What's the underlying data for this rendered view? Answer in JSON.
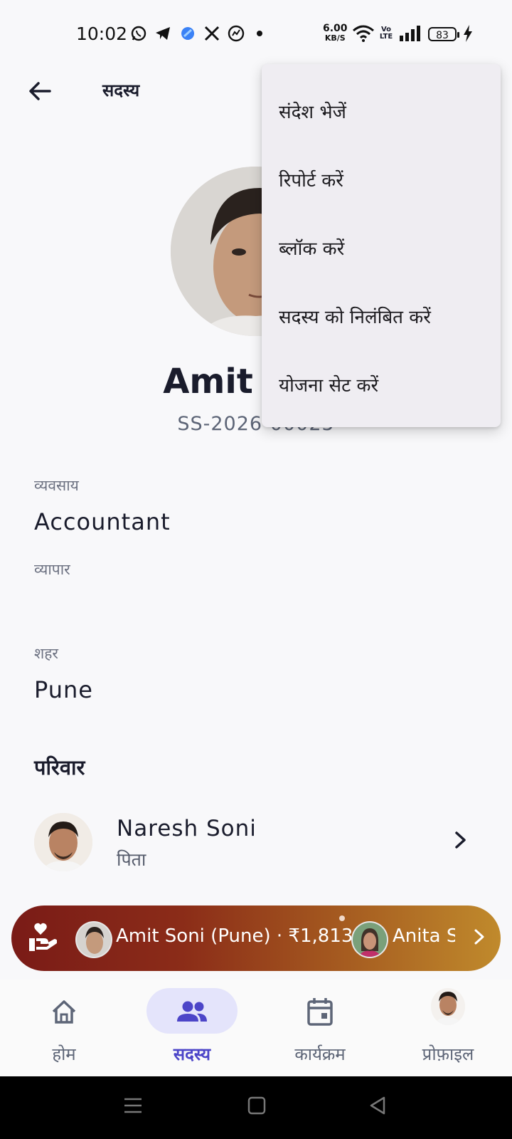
{
  "status_bar": {
    "time": "10:02",
    "net_speed_value": "6.00",
    "net_speed_unit": "KB/S",
    "volte": "Vo LTE",
    "battery": "83",
    "notification_icons": [
      "whatsapp-icon",
      "telegram-icon",
      "app-icon",
      "x-icon",
      "threads-icon",
      "dot-icon"
    ]
  },
  "header": {
    "title": "सदस्य"
  },
  "profile": {
    "name": "Amit Soni",
    "member_id": "SS-2026-00025",
    "fields": [
      {
        "label": "व्यवसाय",
        "value": "Accountant"
      },
      {
        "label": "व्यापार",
        "value": ""
      },
      {
        "label": "शहर",
        "value": "Pune"
      }
    ]
  },
  "family": {
    "title": "परिवार",
    "members": [
      {
        "name": "Naresh Soni",
        "relation": "पिता"
      }
    ]
  },
  "donation_banner": {
    "items": [
      {
        "text": "Amit Soni (Pune) · ₹1,813"
      },
      {
        "text": "Anita S"
      }
    ]
  },
  "bottom_nav": {
    "items": [
      {
        "label": "होम",
        "icon": "home-icon",
        "active": false
      },
      {
        "label": "सदस्य",
        "icon": "members-icon",
        "active": true
      },
      {
        "label": "कार्यक्रम",
        "icon": "calendar-icon",
        "active": false
      },
      {
        "label": "प्रोफ़ाइल",
        "icon": "avatar",
        "active": false
      }
    ]
  },
  "overflow_menu": {
    "items": [
      {
        "label": "संदेश भेजें"
      },
      {
        "label": "रिपोर्ट करें"
      },
      {
        "label": "ब्लॉक करें"
      },
      {
        "label": "सदस्य को निलंबित करें"
      },
      {
        "label": "योजना सेट करें"
      }
    ]
  },
  "colors": {
    "accent": "#4c45c8",
    "nav_pill": "#e4e4fb",
    "banner_start": "#7a1b17",
    "banner_end": "#c08a2c",
    "menu_bg": "#efedf2"
  }
}
